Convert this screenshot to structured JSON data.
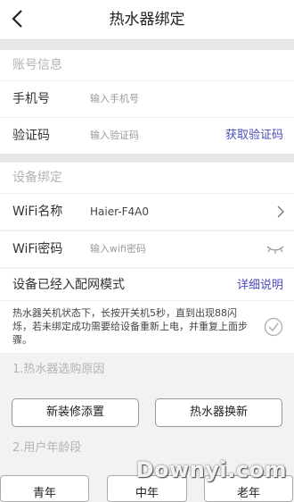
{
  "header": {
    "title": "热水器绑定"
  },
  "account": {
    "section_title": "账号信息",
    "phone_label": "手机号",
    "phone_placeholder": "输入手机号",
    "code_label": "验证码",
    "code_placeholder": "输入验证码",
    "get_code_label": "获取验证码"
  },
  "device": {
    "section_title": "设备绑定",
    "wifi_name_label": "WiFi名称",
    "wifi_name_value": "Haier-F4A0",
    "wifi_pwd_label": "WiFi密码",
    "wifi_pwd_placeholder": "输入wifi密码",
    "network_mode_label": "设备已经入配网模式",
    "details_link": "详细说明",
    "note": "热水器关机状态下，长按开关机5秒，直到出现88闪烁，若未绑定成功需要给设备重新上电，并重复上面步骤。"
  },
  "reason": {
    "title": "1.热水器选购原因",
    "options": [
      "新装修添置",
      "热水器换新"
    ]
  },
  "age": {
    "title": "2.用户年龄段",
    "options": [
      "青年",
      "中年",
      "老年"
    ]
  },
  "watermark": "Downyi.com",
  "colors": {
    "link": "#4b4bb8",
    "section_text": "#b3b3b3"
  }
}
